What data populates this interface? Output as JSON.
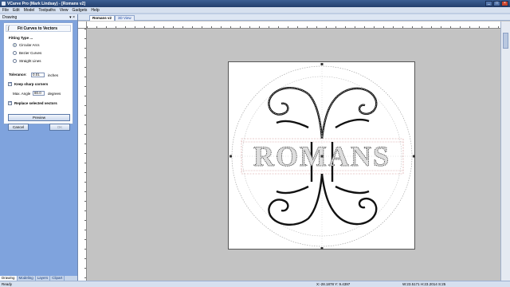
{
  "window": {
    "title": "VCarve Pro (Mark Lindsay) - [Romans v2]",
    "buttons": {
      "minimize": "_",
      "maximize": "□",
      "close": "×"
    }
  },
  "menu": [
    "File",
    "Edit",
    "Model",
    "Toolpaths",
    "View",
    "Gadgets",
    "Help"
  ],
  "panel": {
    "header": "Drawing",
    "pin": "▾ ×",
    "tool_title": "Fit Curves to Vectors",
    "fitting_type_label": "Fitting Type ...",
    "options": [
      {
        "label": "Circular Arcs",
        "selected": true
      },
      {
        "label": "Bezier Curves",
        "selected": false
      },
      {
        "label": "Straight Lines",
        "selected": false
      }
    ],
    "tolerance_label": "Tolerance:",
    "tolerance_value": "0.01",
    "tolerance_unit": "inches",
    "keep_sharp_label": "Keep sharp corners",
    "max_angle_label": "Max. Angle",
    "max_angle_value": "80.0",
    "max_angle_unit": "degrees",
    "replace_label": "Replace selected vectors",
    "preview_label": "Preview",
    "cancel_label": "Cancel",
    "ok_label": "OK",
    "tabs": [
      "Drawing",
      "Modeling",
      "Layers",
      "Clipart"
    ]
  },
  "document": {
    "tabs": [
      "Romans v2",
      "3D View"
    ],
    "artwork_text": "ROMANS"
  },
  "status": {
    "left": "Ready",
    "coords": "X:-28.1878 Y: 9.4397",
    "dims": "W:23.5171  H:23.2014  S:25"
  },
  "colors": {
    "accent": "#2a5ea8",
    "panel_bg": "#7fa3dd",
    "selection": "#d4a0a0"
  }
}
